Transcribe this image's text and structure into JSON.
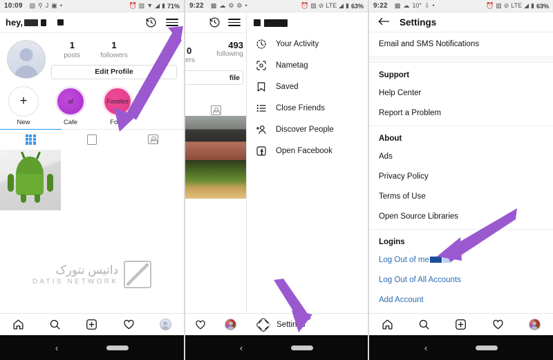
{
  "panels": [
    {
      "id": "profile",
      "status": {
        "time": "10:09",
        "battery": "71%",
        "network": "",
        "icons": [
          "camera-icon",
          "location-icon",
          "j-icon",
          "instagram-icon",
          "dot-icon"
        ]
      },
      "header": {
        "username": "hey,",
        "history_icon": "history-icon",
        "menu_icon": "hamburger-icon"
      },
      "stats": [
        {
          "num": "1",
          "label": "posts"
        },
        {
          "num": "1",
          "label": "followers"
        }
      ],
      "edit_profile": "Edit Profile",
      "highlights": [
        {
          "label": "New",
          "glyph": "+"
        },
        {
          "label": "Cafe",
          "glyph": "af"
        },
        {
          "label": "Food",
          "glyph": "Foodies"
        }
      ],
      "tabs": [
        "grid-tab",
        "reels-tab",
        "tagged-tab"
      ],
      "bottom_nav": [
        "home-icon",
        "search-icon",
        "add-post-icon",
        "activity-heart-icon",
        "profile-avatar-icon"
      ]
    },
    {
      "id": "menu-drawer",
      "status": {
        "time": "9:22",
        "battery": "63%",
        "network": "LTE"
      },
      "peek": {
        "following_num": "493",
        "following_label": "following",
        "followers_num": "0",
        "followers_label": "ers",
        "edit_profile": "file"
      },
      "menu_items": [
        {
          "label": "Your Activity",
          "icon": "activity-clock-icon"
        },
        {
          "label": "Nametag",
          "icon": "nametag-icon"
        },
        {
          "label": "Saved",
          "icon": "bookmark-icon"
        },
        {
          "label": "Close Friends",
          "icon": "close-friends-list-icon"
        },
        {
          "label": "Discover People",
          "icon": "discover-people-icon"
        },
        {
          "label": "Open Facebook",
          "icon": "facebook-icon"
        }
      ],
      "settings_row": {
        "label": "Settings",
        "icon": "gear-icon"
      }
    },
    {
      "id": "settings",
      "status": {
        "time": "9:22",
        "battery": "63%",
        "network": "LTE"
      },
      "title": "Settings",
      "back_icon": "back-arrow-icon",
      "groups": [
        {
          "header": null,
          "items": [
            {
              "label": "Email and SMS Notifications",
              "type": "item"
            }
          ]
        },
        {
          "header": "Support",
          "items": [
            {
              "label": "Help Center",
              "type": "item"
            },
            {
              "label": "Report a Problem",
              "type": "item"
            }
          ]
        },
        {
          "header": "About",
          "items": [
            {
              "label": "Ads",
              "type": "item"
            },
            {
              "label": "Privacy Policy",
              "type": "item"
            },
            {
              "label": "Terms of Use",
              "type": "item"
            },
            {
              "label": "Open Source Libraries",
              "type": "item"
            }
          ]
        },
        {
          "header": "Logins",
          "items": [
            {
              "label": "Log Out of me",
              "type": "link",
              "redacted": true
            },
            {
              "label": "Log Out of All Accounts",
              "type": "link"
            },
            {
              "label": "Add Account",
              "type": "link"
            }
          ]
        }
      ],
      "bottom_nav": [
        "home-icon",
        "search-icon",
        "add-post-icon",
        "activity-heart-icon",
        "profile-avatar-icon"
      ]
    }
  ],
  "watermark": {
    "fa": "داتیس نتورک",
    "en": "DATIS NETWORK"
  },
  "system_nav": {
    "back": "‹",
    "pill": "home-pill"
  },
  "annotations": {
    "arrow_color": "#9b59d0",
    "arrows": [
      {
        "name": "arrow-to-hamburger-menu"
      },
      {
        "name": "arrow-to-settings"
      },
      {
        "name": "arrow-to-log-out"
      }
    ]
  }
}
